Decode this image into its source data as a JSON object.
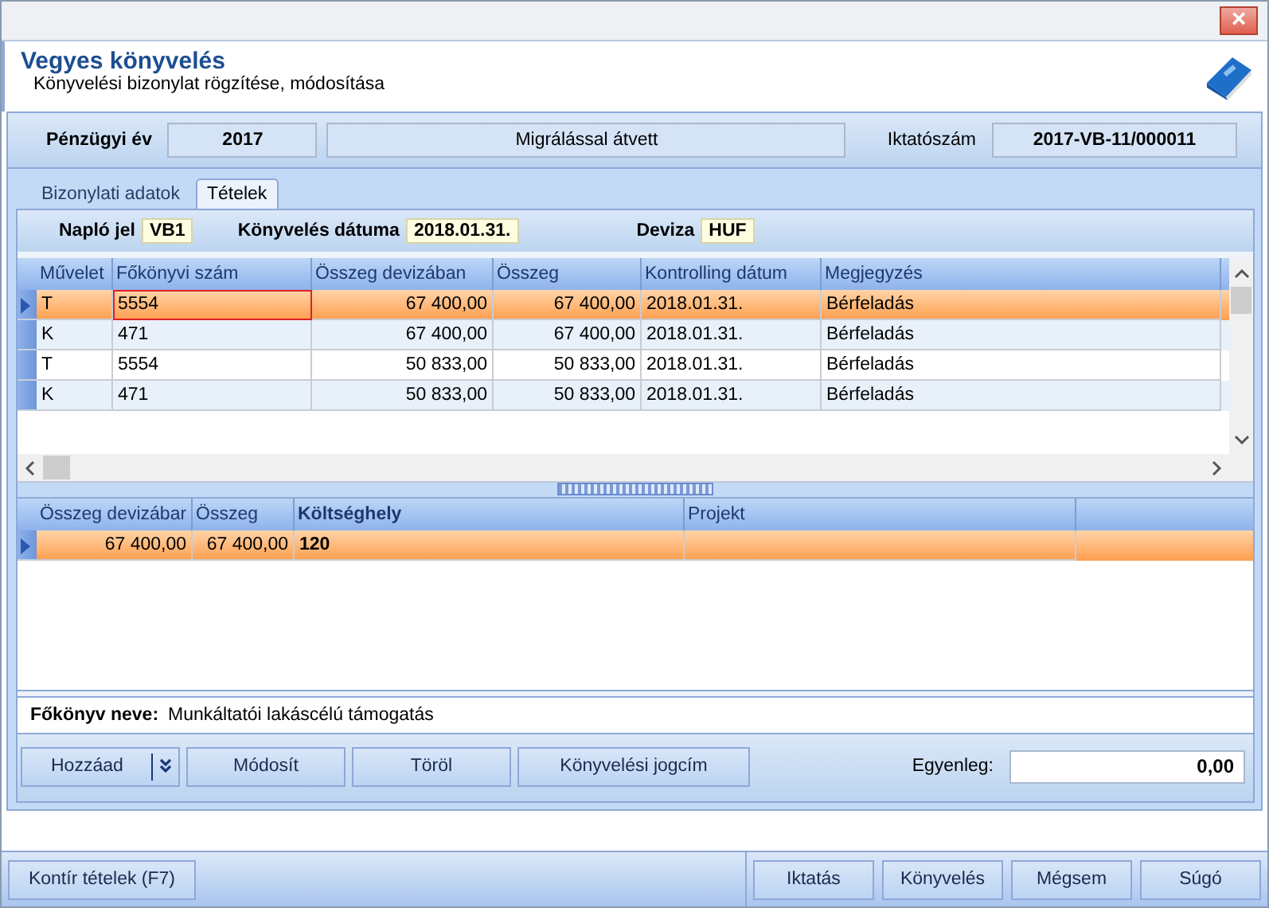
{
  "window": {
    "title_bar": {
      "close": "×"
    }
  },
  "header": {
    "title": "Vegyes könyvelés",
    "subtitle": "Könyvelési bizonylat rögzítése, módosítása"
  },
  "info": {
    "year_label": "Pénzügyi év",
    "year": "2017",
    "status": "Migrálással átvett",
    "number_label": "Iktatószám",
    "number": "2017-VB-11/000011"
  },
  "tabs": [
    {
      "label": "Bizonylati adatok",
      "selected": false
    },
    {
      "label": "Tételek",
      "selected": true
    }
  ],
  "journal": {
    "journal_label": "Napló jel",
    "journal": "VB1",
    "date_label": "Könyvelés dátuma",
    "date": "2018.01.31.",
    "currency_label": "Deviza",
    "currency": "HUF"
  },
  "table": {
    "columns": [
      {
        "label": "Művelet",
        "kind": "text"
      },
      {
        "label": "Főkönyvi szám",
        "kind": "text"
      },
      {
        "label": "Összeg devizában",
        "kind": "number"
      },
      {
        "label": "Összeg",
        "kind": "number"
      },
      {
        "label": "Kontrolling dátum",
        "kind": "text"
      },
      {
        "label": "Megjegyzés",
        "kind": "text"
      }
    ],
    "rows": [
      {
        "selected": true,
        "focused": true,
        "cells": [
          "T",
          "5554",
          "67 400,00",
          "67 400,00",
          "2018.01.31.",
          "Bérfeladás"
        ]
      },
      {
        "selected": false,
        "focused": false,
        "cells": [
          "K",
          "471",
          "67 400,00",
          "67 400,00",
          "2018.01.31.",
          "Bérfeladás"
        ]
      },
      {
        "selected": false,
        "focused": false,
        "cells": [
          "T",
          "5554",
          "50 833,00",
          "50 833,00",
          "2018.01.31.",
          "Bérfeladás"
        ]
      },
      {
        "selected": false,
        "focused": false,
        "cells": [
          "K",
          "471",
          "50 833,00",
          "50 833,00",
          "2018.01.31.",
          "Bérfeladás"
        ]
      }
    ]
  },
  "detail_table": {
    "columns": [
      {
        "label": "Összeg devizábar",
        "kind": "number"
      },
      {
        "label": "Összeg",
        "kind": "number"
      },
      {
        "label": "Költséghely",
        "kind": "bold"
      },
      {
        "label": "Projekt",
        "kind": "text"
      }
    ],
    "rows": [
      {
        "selected": true,
        "cells": [
          "67 400,00",
          "67 400,00",
          "120",
          ""
        ]
      }
    ]
  },
  "account": {
    "label": "Főkönyv neve:",
    "value": "Munkáltatói lakáscélú támogatás"
  },
  "actions": {
    "buttons": [
      "Hozzáad",
      "Módosít",
      "Töröl",
      "Könyvelési jogcím"
    ],
    "balance_label": "Egyenleg:",
    "balance": "0,00"
  },
  "footer": {
    "left_button": "Kontír tételek (F7)",
    "buttons": [
      "Iktatás",
      "Könyvelés",
      "Mégsem",
      "Súgó"
    ]
  }
}
